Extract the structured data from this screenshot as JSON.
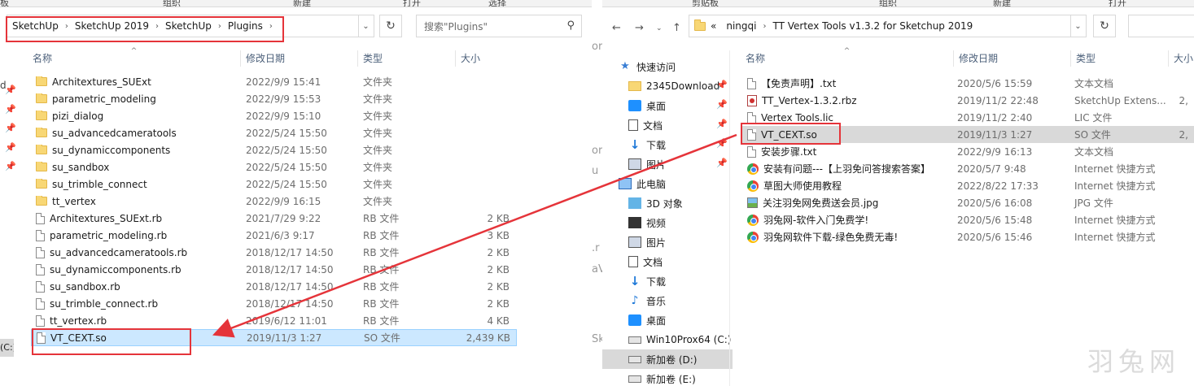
{
  "left": {
    "ribbon": [
      "板",
      "组织",
      "新建",
      "打开",
      "选择"
    ],
    "breadcrumb": [
      "SketchUp",
      "SketchUp 2019",
      "SketchUp",
      "Plugins"
    ],
    "search_placeholder": "搜索\"Plugins\"",
    "columns": [
      "名称",
      "修改日期",
      "类型",
      "大小"
    ],
    "files": [
      {
        "name": "Architextures_SUExt",
        "date": "2022/9/9 15:41",
        "type": "文件夹",
        "size": "",
        "icon": "folder-icon"
      },
      {
        "name": "parametric_modeling",
        "date": "2022/9/9 15:53",
        "type": "文件夹",
        "size": "",
        "icon": "folder-icon"
      },
      {
        "name": "pizi_dialog",
        "date": "2022/9/9 15:10",
        "type": "文件夹",
        "size": "",
        "icon": "folder-icon"
      },
      {
        "name": "su_advancedcameratools",
        "date": "2022/5/24 15:50",
        "type": "文件夹",
        "size": "",
        "icon": "folder-icon"
      },
      {
        "name": "su_dynamiccomponents",
        "date": "2022/5/24 15:50",
        "type": "文件夹",
        "size": "",
        "icon": "folder-icon"
      },
      {
        "name": "su_sandbox",
        "date": "2022/5/24 15:50",
        "type": "文件夹",
        "size": "",
        "icon": "folder-icon"
      },
      {
        "name": "su_trimble_connect",
        "date": "2022/5/24 15:50",
        "type": "文件夹",
        "size": "",
        "icon": "folder-icon"
      },
      {
        "name": "tt_vertex",
        "date": "2022/9/9 16:15",
        "type": "文件夹",
        "size": "",
        "icon": "folder-icon"
      },
      {
        "name": "Architextures_SUExt.rb",
        "date": "2021/7/29 9:22",
        "type": "RB 文件",
        "size": "2 KB",
        "icon": "file-icon"
      },
      {
        "name": "parametric_modeling.rb",
        "date": "2021/6/3 9:17",
        "type": "RB 文件",
        "size": "3 KB",
        "icon": "file-icon"
      },
      {
        "name": "su_advancedcameratools.rb",
        "date": "2018/12/17 14:50",
        "type": "RB 文件",
        "size": "2 KB",
        "icon": "file-icon"
      },
      {
        "name": "su_dynamiccomponents.rb",
        "date": "2018/12/17 14:50",
        "type": "RB 文件",
        "size": "2 KB",
        "icon": "file-icon"
      },
      {
        "name": "su_sandbox.rb",
        "date": "2018/12/17 14:50",
        "type": "RB 文件",
        "size": "2 KB",
        "icon": "file-icon"
      },
      {
        "name": "su_trimble_connect.rb",
        "date": "2018/12/17 14:50",
        "type": "RB 文件",
        "size": "2 KB",
        "icon": "file-icon"
      },
      {
        "name": "tt_vertex.rb",
        "date": "2019/6/12 11:01",
        "type": "RB 文件",
        "size": "4 KB",
        "icon": "file-icon"
      },
      {
        "name": "VT_CEXT.so",
        "date": "2019/11/3 1:27",
        "type": "SO 文件",
        "size": "2,439 KB",
        "icon": "file-icon",
        "selected": true
      }
    ],
    "edge_left_text": "(C:)",
    "edge_left_d": "d"
  },
  "right": {
    "ribbon": [
      "剪贴板",
      "组织",
      "新建",
      "打开"
    ],
    "breadcrumb_prefix": "«",
    "breadcrumb": [
      "ningqi",
      "TT Vertex Tools v1.3.2 for Sketchup 2019"
    ],
    "columns": [
      "名称",
      "修改日期",
      "类型",
      "大小"
    ],
    "files": [
      {
        "name": "【免责声明】.txt",
        "date": "2020/5/6 15:59",
        "type": "文本文档",
        "size": "",
        "icon": "file-icon"
      },
      {
        "name": "TT_Vertex-1.3.2.rbz",
        "date": "2019/11/2 22:48",
        "type": "SketchUp Extens...",
        "size": "2,",
        "icon": "rbz-icon"
      },
      {
        "name": "Vertex Tools.lic",
        "date": "2019/11/2 2:40",
        "type": "LIC 文件",
        "size": "",
        "icon": "file-icon"
      },
      {
        "name": "VT_CEXT.so",
        "date": "2019/11/3 1:27",
        "type": "SO 文件",
        "size": "2,",
        "icon": "file-icon",
        "selected": true
      },
      {
        "name": "安装步骤.txt",
        "date": "2022/9/9 16:13",
        "type": "文本文档",
        "size": "",
        "icon": "file-icon"
      },
      {
        "name": "安装有问题---【上羽免问答搜索答案】",
        "date": "2020/5/7 9:48",
        "type": "Internet 快捷方式",
        "size": "",
        "icon": "chrome-icon"
      },
      {
        "name": "草图大师使用教程",
        "date": "2022/8/22 17:33",
        "type": "Internet 快捷方式",
        "size": "",
        "icon": "chrome-icon"
      },
      {
        "name": "关注羽免网免费送会员.jpg",
        "date": "2020/5/6 16:08",
        "type": "JPG 文件",
        "size": "",
        "icon": "jpg-icon"
      },
      {
        "name": "羽兔网-软件入门免费学!",
        "date": "2020/5/6 15:48",
        "type": "Internet 快捷方式",
        "size": "",
        "icon": "chrome-icon"
      },
      {
        "name": "羽兔网软件下载-绿色免费无毒!",
        "date": "2020/5/6 15:46",
        "type": "Internet 快捷方式",
        "size": "",
        "icon": "chrome-icon"
      }
    ],
    "tree": [
      {
        "label": "快速访问",
        "icon": "star-icon",
        "pin": false
      },
      {
        "label": "2345Download",
        "icon": "folder-icon",
        "pin": true
      },
      {
        "label": "桌面",
        "icon": "desktop-icon",
        "pin": true
      },
      {
        "label": "文档",
        "icon": "document-icon",
        "pin": true
      },
      {
        "label": "下载",
        "icon": "download-icon",
        "pin": true
      },
      {
        "label": "图片",
        "icon": "picture-icon",
        "pin": true
      },
      {
        "label": "此电脑",
        "icon": "computer-icon",
        "pin": false
      },
      {
        "label": "3D 对象",
        "icon": "3d-objects-icon",
        "pin": false
      },
      {
        "label": "视频",
        "icon": "video-icon",
        "pin": false
      },
      {
        "label": "图片",
        "icon": "picture-icon",
        "pin": false
      },
      {
        "label": "文档",
        "icon": "document-icon",
        "pin": false
      },
      {
        "label": "下载",
        "icon": "download-icon",
        "pin": false
      },
      {
        "label": "音乐",
        "icon": "music-icon",
        "pin": false
      },
      {
        "label": "桌面",
        "icon": "desktop-icon",
        "pin": false
      },
      {
        "label": "Win10Prox64 (C:)",
        "icon": "drive-icon",
        "pin": false
      },
      {
        "label": "新加卷 (D:)",
        "icon": "drive-icon",
        "pin": false,
        "selected": true
      },
      {
        "label": "新加卷 (E:)",
        "icon": "drive-icon",
        "pin": false
      }
    ]
  },
  "background_glimpse": [
    "or",
    "u",
    "or",
    "u",
    "i",
    ".r",
    "aV",
    "Sk"
  ],
  "watermark": "羽兔网",
  "colors": {
    "highlight_box": "#e5343a",
    "selection": "#cce8ff",
    "folder": "#f8d775"
  }
}
